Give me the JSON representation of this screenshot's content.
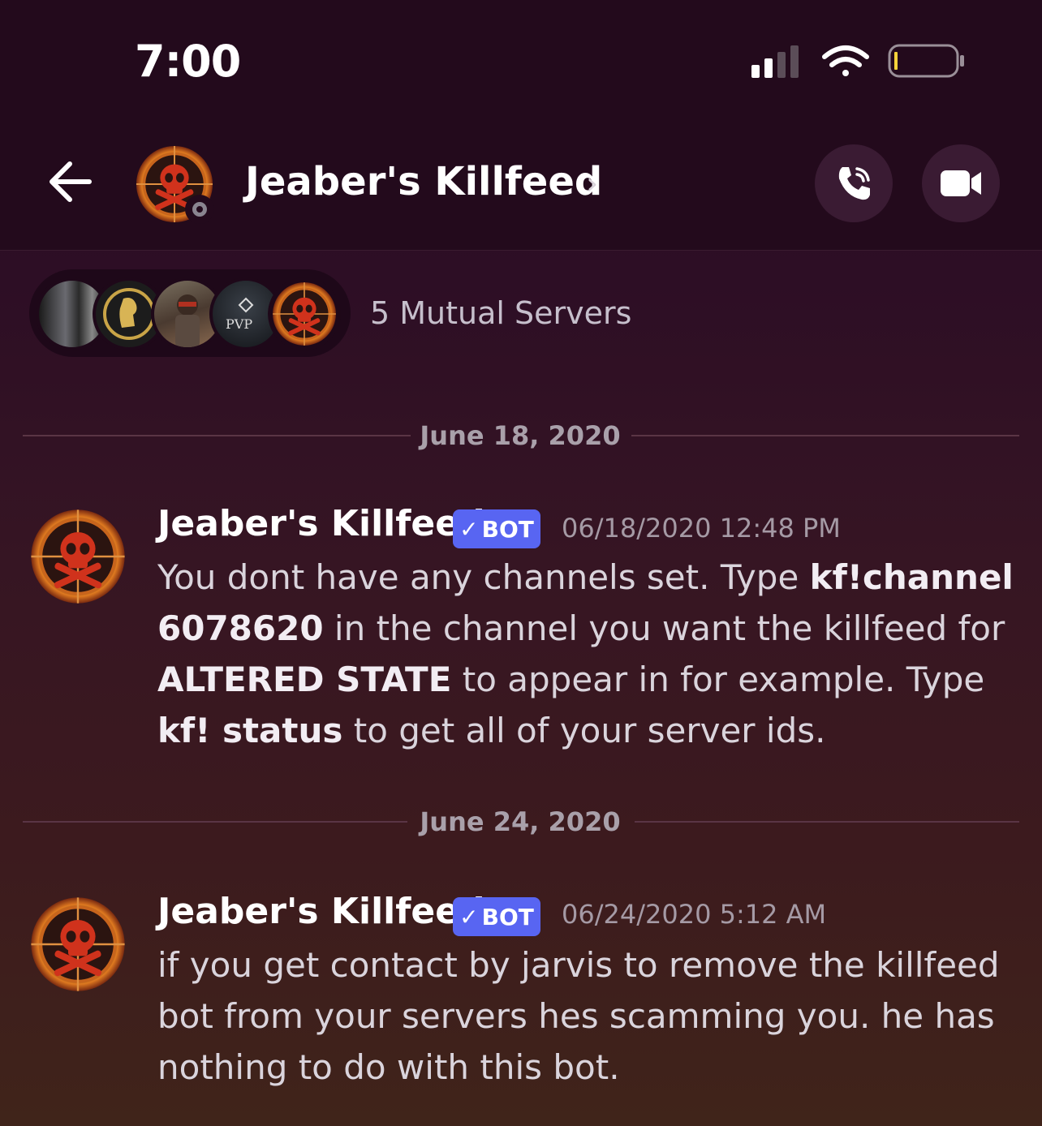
{
  "status_bar": {
    "time": "7:00"
  },
  "header": {
    "title": "Jeaber's Killfeed",
    "chevron": "›"
  },
  "mutual": {
    "label": "5 Mutual Servers",
    "pvp_text": "PVP"
  },
  "dates": [
    "June 18, 2020",
    "June 24, 2020"
  ],
  "messages": [
    {
      "author": "Jeaber's Killfeed",
      "badge": "BOT",
      "badge_check": "✓",
      "timestamp": "06/18/2020 12:48 PM",
      "parts": [
        {
          "t": "You dont have any channels set. Type "
        },
        {
          "t": "kf!channel 6078620",
          "b": true
        },
        {
          "t": " in the channel you want the killfeed for "
        },
        {
          "t": "ALTERED STATE",
          "b": true
        },
        {
          "t": " to appear in for example. Type "
        },
        {
          "t": "kf! status",
          "b": true
        },
        {
          "t": " to get all of your server ids."
        }
      ]
    },
    {
      "author": "Jeaber's Killfeed",
      "badge": "BOT",
      "badge_check": "✓",
      "timestamp": "06/24/2020 5:12 AM",
      "parts": [
        {
          "t": "if you get contact by jarvis to remove the killfeed bot from your servers hes scamming you. he has nothing to do with this bot."
        }
      ]
    }
  ],
  "colors": {
    "bot_badge": "#5865f2",
    "accent_red": "#d0321c",
    "background_top": "#2a0f22",
    "background_bottom": "#40241a"
  },
  "icons": [
    "back-arrow-icon",
    "skull-crosshair-icon",
    "phone-call-icon",
    "video-camera-icon",
    "wifi-icon",
    "signal-bars-icon",
    "battery-icon"
  ]
}
